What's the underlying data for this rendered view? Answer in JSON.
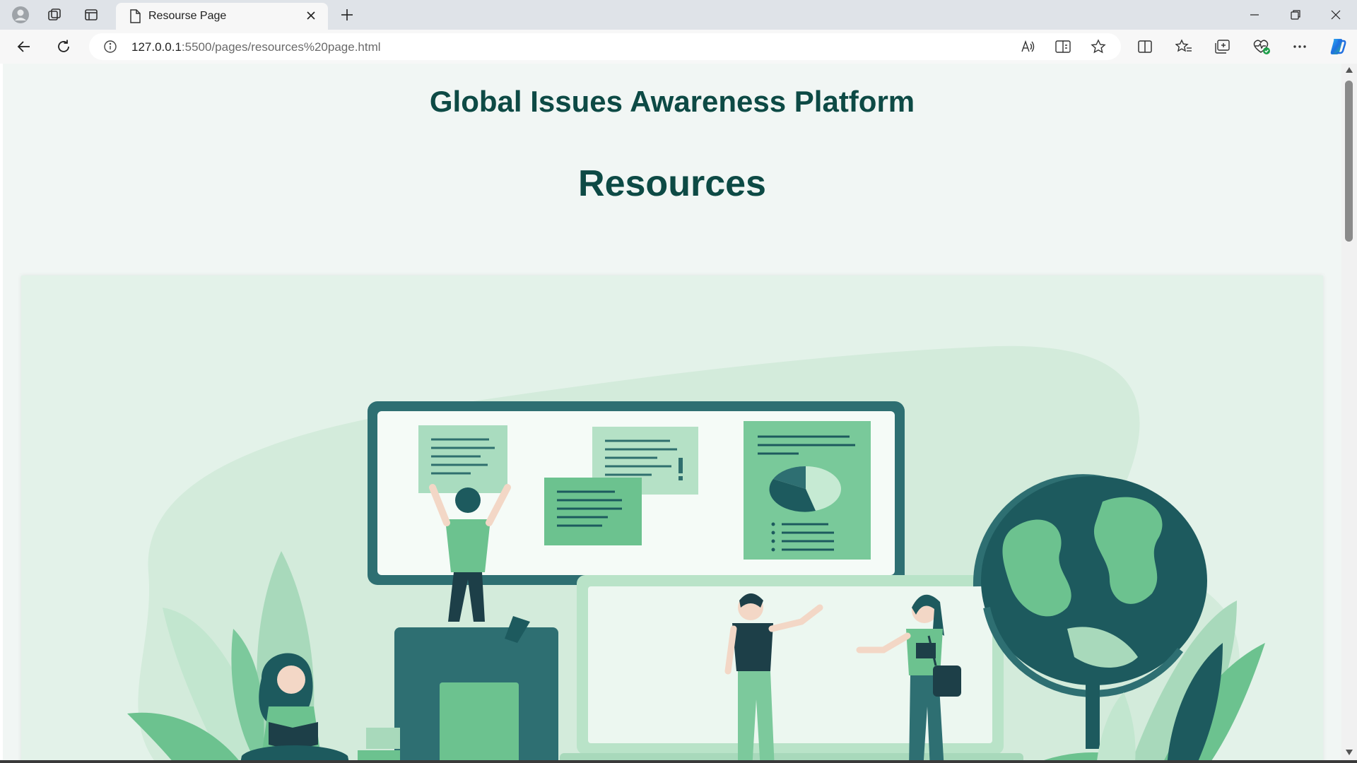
{
  "browser": {
    "tab_title": "Resourse Page",
    "url_host": "127.0.0.1",
    "url_rest": ":5500/pages/resources%20page.html",
    "icons": {
      "profile": "profile-icon",
      "workspaces": "workspaces-icon",
      "tab_actions": "vertical-tabs-icon",
      "page": "page-icon",
      "close_tab": "close-icon",
      "new_tab": "plus-icon",
      "minimize": "minimize-icon",
      "restore": "restore-icon",
      "close_window": "close-icon",
      "back": "back-arrow-icon",
      "refresh": "refresh-icon",
      "site_info": "info-icon",
      "read_aloud": "read-aloud-icon",
      "immersive_reader": "immersive-reader-icon",
      "favorite": "star-icon",
      "split_screen": "split-screen-icon",
      "favorites": "favorites-icon",
      "collections": "collections-icon",
      "browser_essentials": "heart-pulse-icon",
      "more": "more-icon",
      "copilot": "copilot-icon"
    }
  },
  "page": {
    "site_title": "Global Issues Awareness Platform",
    "heading": "Resources",
    "hero_image": "resources-illustration"
  },
  "colors": {
    "title": "#0d4a45",
    "page_bg": "#f1f6f4",
    "card_bg": "#e3f2e9",
    "accent_green": "#6cc28f",
    "dark_teal": "#1d5a5e"
  }
}
